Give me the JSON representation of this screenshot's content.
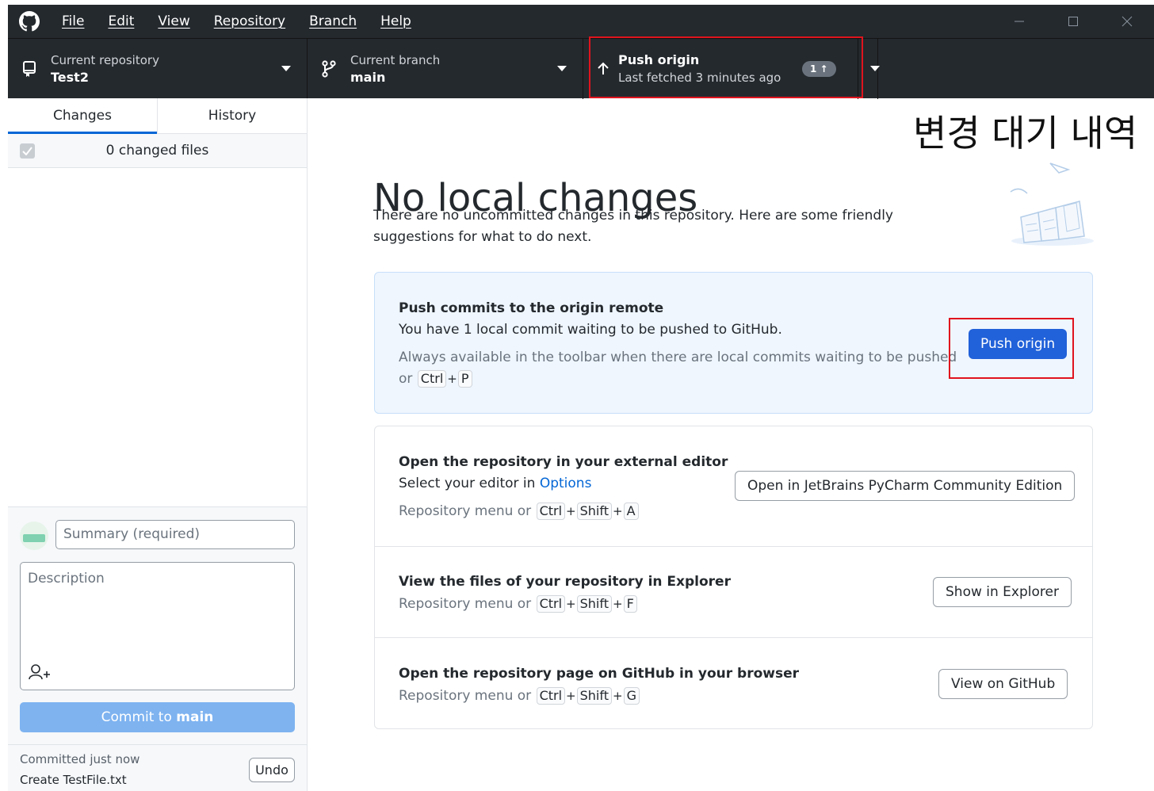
{
  "menu": {
    "items": [
      "File",
      "Edit",
      "View",
      "Repository",
      "Branch",
      "Help"
    ]
  },
  "toolbar": {
    "repository_label": "Current repository",
    "repository_name": "Test2",
    "branch_label": "Current branch",
    "branch_name": "main",
    "push_title": "Push origin",
    "push_subtitle": "Last fetched 3 minutes ago",
    "push_badge": "1 ↑"
  },
  "annotation": "변경 대기 내역",
  "sidebar": {
    "tabs": [
      {
        "label": "Changes",
        "active": true
      },
      {
        "label": "History",
        "active": false
      }
    ],
    "changed_files": "0 changed files",
    "summary_placeholder": "Summary (required)",
    "description_placeholder": "Description",
    "commit_prefix": "Commit to",
    "commit_branch": "main",
    "last_commit_time": "Committed just now",
    "last_commit_message": "Create TestFile.txt",
    "undo_label": "Undo"
  },
  "main": {
    "title": "No local changes",
    "subtitle": "There are no uncommitted changes in this repository. Here are some friendly suggestions for what to do next.",
    "push_card": {
      "title": "Push commits to the origin remote",
      "desc": "You have 1 local commit waiting to be pushed to GitHub.",
      "hint": "Always available in the toolbar when there are local commits waiting to be pushed",
      "hint_or": "or",
      "keys": [
        "Ctrl",
        "P"
      ],
      "button": "Push origin"
    },
    "editor_card": {
      "title": "Open the repository in your external editor",
      "desc_prefix": "Select your editor in",
      "desc_link": "Options",
      "hint": "Repository menu or",
      "keys": [
        "Ctrl",
        "Shift",
        "A"
      ],
      "button": "Open in JetBrains PyCharm Community Edition"
    },
    "explorer_card": {
      "title": "View the files of your repository in Explorer",
      "hint": "Repository menu or",
      "keys": [
        "Ctrl",
        "Shift",
        "F"
      ],
      "button": "Show in Explorer"
    },
    "github_card": {
      "title": "Open the repository page on GitHub in your browser",
      "hint": "Repository menu or",
      "keys": [
        "Ctrl",
        "Shift",
        "G"
      ],
      "button": "View on GitHub"
    }
  },
  "colors": {
    "toolbar_bg": "#24292e",
    "primary_button": "#2161d9",
    "commit_button": "#7eb3f0",
    "highlight": "#e0141e",
    "link": "#0366d6"
  }
}
